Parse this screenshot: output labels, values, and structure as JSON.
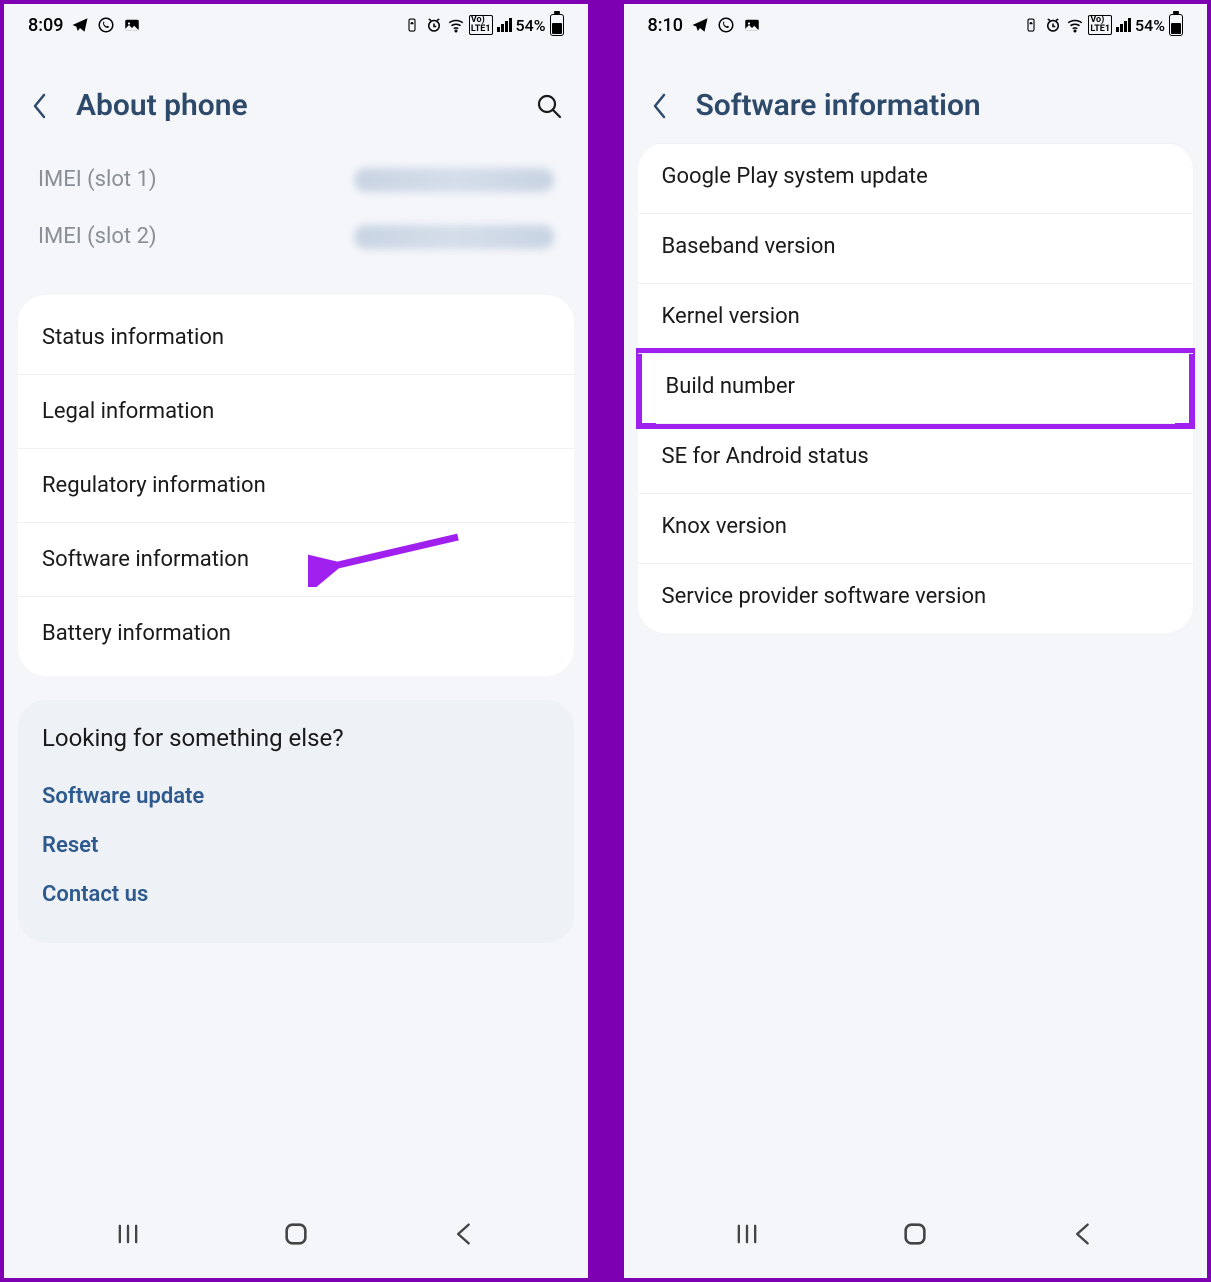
{
  "left": {
    "status": {
      "time": "8:09",
      "battery": "54%"
    },
    "header": {
      "title": "About phone"
    },
    "imei": [
      {
        "label": "IMEI (slot 1)"
      },
      {
        "label": "IMEI (slot 2)"
      }
    ],
    "items": [
      "Status information",
      "Legal information",
      "Regulatory information",
      "Software information",
      "Battery information"
    ],
    "looking": {
      "title": "Looking for something else?",
      "links": [
        "Software update",
        "Reset",
        "Contact us"
      ]
    }
  },
  "right": {
    "status": {
      "time": "8:10",
      "battery": "54%"
    },
    "header": {
      "title": "Software information"
    },
    "items": [
      "Google Play system update",
      "Baseband version",
      "Kernel version",
      "Build number",
      "SE for Android status",
      "Knox version",
      "Service provider software version"
    ]
  }
}
